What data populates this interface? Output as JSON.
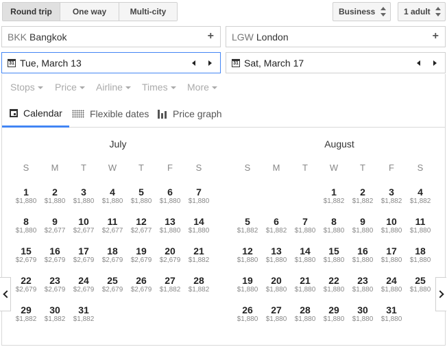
{
  "trip_type": {
    "options": [
      "Round trip",
      "One way",
      "Multi-city"
    ],
    "selected": "Round trip"
  },
  "cabin": {
    "value": "Business"
  },
  "passengers": {
    "value": "1 adult"
  },
  "origin": {
    "code": "BKK",
    "city": "Bangkok",
    "add_label": "+"
  },
  "destination": {
    "code": "LGW",
    "city": "London",
    "add_label": "+"
  },
  "depart_date": {
    "label": "Tue, March 13",
    "icon_text": "31"
  },
  "return_date": {
    "label": "Sat, March 17",
    "icon_text": "31"
  },
  "filters": [
    "Stops",
    "Price",
    "Airline",
    "Times",
    "More"
  ],
  "view_tabs": [
    "Calendar",
    "Flexible dates",
    "Price graph"
  ],
  "active_view": "Calendar",
  "weekdays": [
    "S",
    "M",
    "T",
    "W",
    "T",
    "F",
    "S"
  ],
  "months": [
    {
      "name": "July",
      "days": [
        {
          "d": "1",
          "p": "$1,880"
        },
        {
          "d": "2",
          "p": "$1,880"
        },
        {
          "d": "3",
          "p": "$1,880"
        },
        {
          "d": "4",
          "p": "$1,880"
        },
        {
          "d": "5",
          "p": "$1,880"
        },
        {
          "d": "6",
          "p": "$1,880"
        },
        {
          "d": "7",
          "p": "$1,880"
        },
        {
          "d": "8",
          "p": "$1,880"
        },
        {
          "d": "9",
          "p": "$2,677"
        },
        {
          "d": "10",
          "p": "$2,677"
        },
        {
          "d": "11",
          "p": "$2,677"
        },
        {
          "d": "12",
          "p": "$2,677"
        },
        {
          "d": "13",
          "p": "$1,880"
        },
        {
          "d": "14",
          "p": "$1,880"
        },
        {
          "d": "15",
          "p": "$2,679"
        },
        {
          "d": "16",
          "p": "$2,679"
        },
        {
          "d": "17",
          "p": "$2,679"
        },
        {
          "d": "18",
          "p": "$2,679"
        },
        {
          "d": "19",
          "p": "$2,679"
        },
        {
          "d": "20",
          "p": "$2,679"
        },
        {
          "d": "21",
          "p": "$1,882"
        },
        {
          "d": "22",
          "p": "$2,679"
        },
        {
          "d": "23",
          "p": "$2,679"
        },
        {
          "d": "24",
          "p": "$2,679"
        },
        {
          "d": "25",
          "p": "$2,679"
        },
        {
          "d": "26",
          "p": "$2,679"
        },
        {
          "d": "27",
          "p": "$1,882"
        },
        {
          "d": "28",
          "p": "$1,882"
        },
        {
          "d": "29",
          "p": "$1,882"
        },
        {
          "d": "30",
          "p": "$1,882"
        },
        {
          "d": "31",
          "p": "$1,882"
        }
      ]
    },
    {
      "name": "August",
      "days": [
        {
          "d": "1",
          "p": "$1,882"
        },
        {
          "d": "2",
          "p": "$1,882"
        },
        {
          "d": "3",
          "p": "$1,882"
        },
        {
          "d": "4",
          "p": "$1,882"
        },
        {
          "d": "5",
          "p": "$1,882"
        },
        {
          "d": "6",
          "p": "$1,882"
        },
        {
          "d": "7",
          "p": "$1,880"
        },
        {
          "d": "8",
          "p": "$1,880"
        },
        {
          "d": "9",
          "p": "$1,880"
        },
        {
          "d": "10",
          "p": "$1,880"
        },
        {
          "d": "11",
          "p": "$1,880"
        },
        {
          "d": "12",
          "p": "$1,880"
        },
        {
          "d": "13",
          "p": "$1,880"
        },
        {
          "d": "14",
          "p": "$1,880"
        },
        {
          "d": "15",
          "p": "$1,880"
        },
        {
          "d": "16",
          "p": "$1,880"
        },
        {
          "d": "17",
          "p": "$1,880"
        },
        {
          "d": "18",
          "p": "$1,880"
        },
        {
          "d": "19",
          "p": "$1,880"
        },
        {
          "d": "20",
          "p": "$1,880"
        },
        {
          "d": "21",
          "p": "$1,880"
        },
        {
          "d": "22",
          "p": "$1,880"
        },
        {
          "d": "23",
          "p": "$1,880"
        },
        {
          "d": "24",
          "p": "$1,880"
        },
        {
          "d": "25",
          "p": "$1,880"
        },
        {
          "d": "26",
          "p": "$1,880"
        },
        {
          "d": "27",
          "p": "$1,880"
        },
        {
          "d": "28",
          "p": "$1,880"
        },
        {
          "d": "29",
          "p": "$1,880"
        },
        {
          "d": "30",
          "p": "$1,880"
        },
        {
          "d": "31",
          "p": "$1,880"
        }
      ]
    }
  ],
  "colors": {
    "accent": "#4285f4",
    "price_text": "#888888",
    "filter_text": "#aaaaaa"
  }
}
